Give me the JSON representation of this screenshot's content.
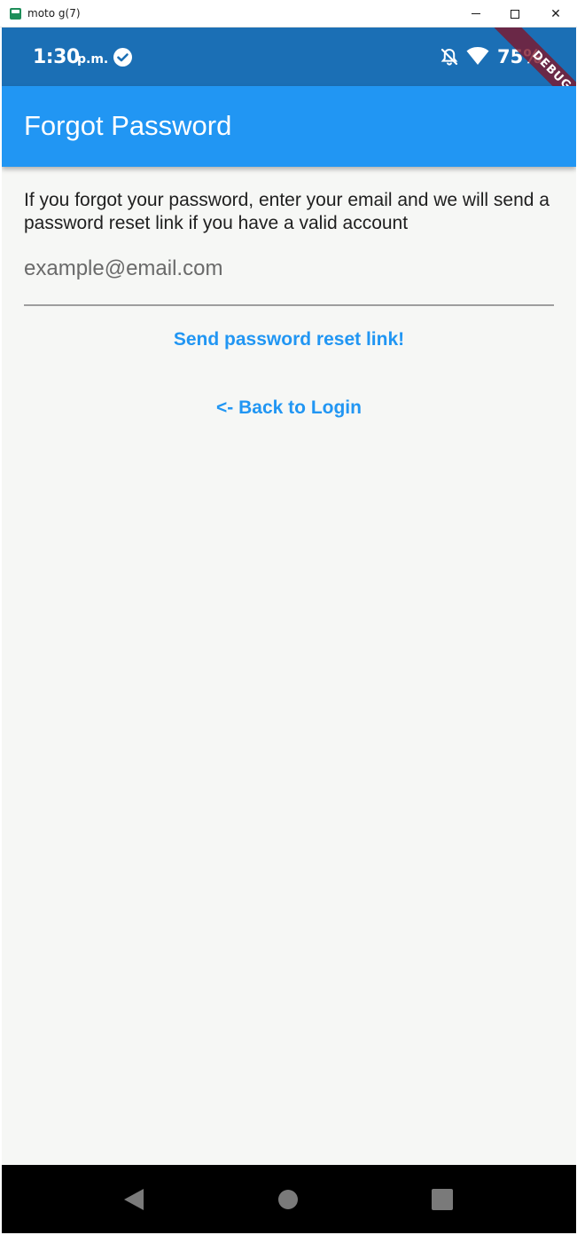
{
  "window": {
    "title": "moto g(7)",
    "close_glyph": "✕"
  },
  "status_bar": {
    "time": "1:30",
    "ampm": "p.m.",
    "battery": "75%",
    "debug_banner": "DEBUG",
    "color": "#1b6fb5"
  },
  "app_bar": {
    "title": "Forgot Password",
    "color": "#2196f3"
  },
  "form": {
    "intro": "If you forgot your password, enter your email and we will send a password reset link if you have a valid account",
    "email_placeholder": "example@email.com",
    "email_value": "",
    "send_label": "Send password reset link!",
    "back_label": "<- Back to Login"
  },
  "icons": {
    "status_left": "check-circle-icon",
    "status_right": [
      "bell-off-icon",
      "wifi-icon"
    ],
    "nav": [
      "back-triangle-icon",
      "home-circle-icon",
      "recent-square-icon"
    ]
  }
}
